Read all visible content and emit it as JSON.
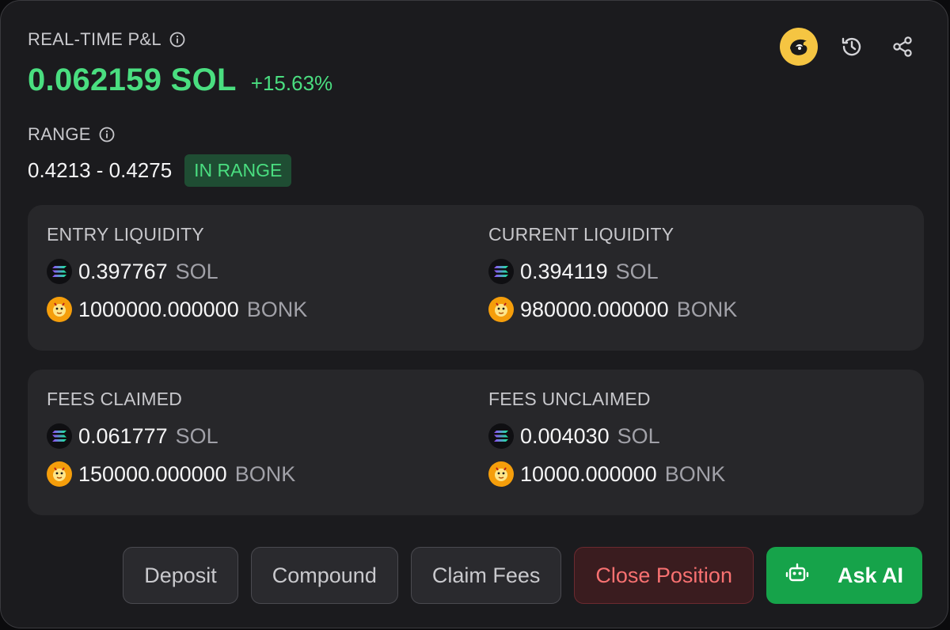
{
  "pnl": {
    "label": "REAL-TIME P&L",
    "value": "0.062159 SOL",
    "percent": "+15.63%"
  },
  "range": {
    "label": "RANGE",
    "value": "0.4213 - 0.4275",
    "status": "IN RANGE"
  },
  "liquidity": {
    "entry": {
      "title": "ENTRY LIQUIDITY",
      "sol_amount": "0.397767",
      "sol_symbol": "SOL",
      "bonk_amount": "1000000.000000",
      "bonk_symbol": "BONK"
    },
    "current": {
      "title": "CURRENT LIQUIDITY",
      "sol_amount": "0.394119",
      "sol_symbol": "SOL",
      "bonk_amount": "980000.000000",
      "bonk_symbol": "BONK"
    }
  },
  "fees": {
    "claimed": {
      "title": "FEES CLAIMED",
      "sol_amount": "0.061777",
      "sol_symbol": "SOL",
      "bonk_amount": "150000.000000",
      "bonk_symbol": "BONK"
    },
    "unclaimed": {
      "title": "FEES UNCLAIMED",
      "sol_amount": "0.004030",
      "sol_symbol": "SOL",
      "bonk_amount": "10000.000000",
      "bonk_symbol": "BONK"
    }
  },
  "actions": {
    "deposit": "Deposit",
    "compound": "Compound",
    "claim_fees": "Claim Fees",
    "close_position": "Close Position",
    "ask_ai": "Ask AI"
  },
  "icons": {
    "info": "info-icon",
    "history": "history-icon",
    "share": "share-icon",
    "avatar": "profile-avatar",
    "sol": "solana-token-icon",
    "bonk": "bonk-token-icon",
    "robot": "robot-icon"
  },
  "colors": {
    "positive": "#4ade80",
    "danger": "#f87171",
    "primary": "#16a34a",
    "card": "#1b1b1e",
    "panel": "#27272a"
  }
}
